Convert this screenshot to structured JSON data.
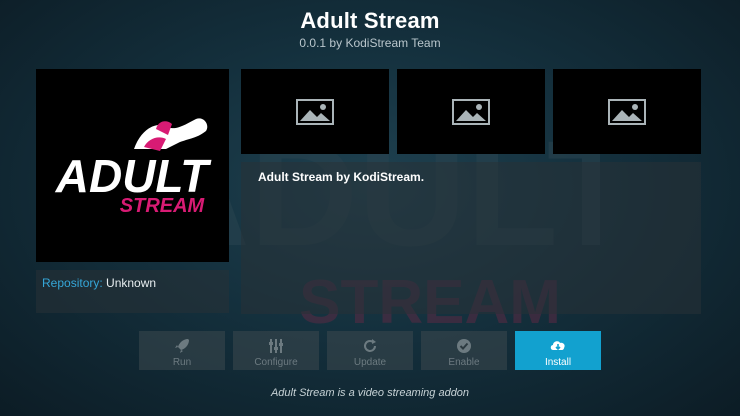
{
  "header": {
    "title": "Adult Stream",
    "subtitle": "0.0.1 by KodiStream Team"
  },
  "logo": {
    "word1": "ADULT",
    "word2": "STREAM",
    "colors": {
      "white": "#ffffff",
      "pink": "#d81b74"
    }
  },
  "repository": {
    "label": "Repository:",
    "value": "Unknown"
  },
  "screenshots": [
    {
      "icon": "image-placeholder-icon"
    },
    {
      "icon": "image-placeholder-icon"
    },
    {
      "icon": "image-placeholder-icon"
    }
  ],
  "description": "Adult Stream by KodiStream.",
  "buttons": [
    {
      "label": "Run",
      "icon": "rocket-icon",
      "enabled": false
    },
    {
      "label": "Configure",
      "icon": "sliders-icon",
      "enabled": false
    },
    {
      "label": "Update",
      "icon": "refresh-icon",
      "enabled": false
    },
    {
      "label": "Enable",
      "icon": "check-icon",
      "enabled": false
    },
    {
      "label": "Install",
      "icon": "cloud-download-icon",
      "enabled": true,
      "focused": true
    }
  ],
  "footer": "Adult Stream is a video streaming addon",
  "colors": {
    "accent": "#12a1cf",
    "repo_label": "#35a6d8"
  }
}
